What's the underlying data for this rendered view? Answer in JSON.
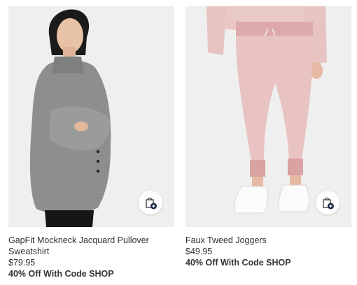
{
  "products": [
    {
      "name": "GapFit Mockneck Jacquard Pullover Sweatshirt",
      "price": "$79.95",
      "promo": "40% Off With Code SHOP",
      "quick_add_icon": "shopping-bag-plus-icon",
      "image_subject": "woman in grey mockneck pullover"
    },
    {
      "name": "Faux Tweed Joggers",
      "price": "$49.95",
      "promo": "40% Off With Code SHOP",
      "quick_add_icon": "shopping-bag-plus-icon",
      "image_subject": "pink tweed joggers with white sneakers"
    }
  ],
  "colors": {
    "text": "#333333",
    "image_background": "#eeeeee",
    "bag_badge": "#1b2a4a"
  }
}
